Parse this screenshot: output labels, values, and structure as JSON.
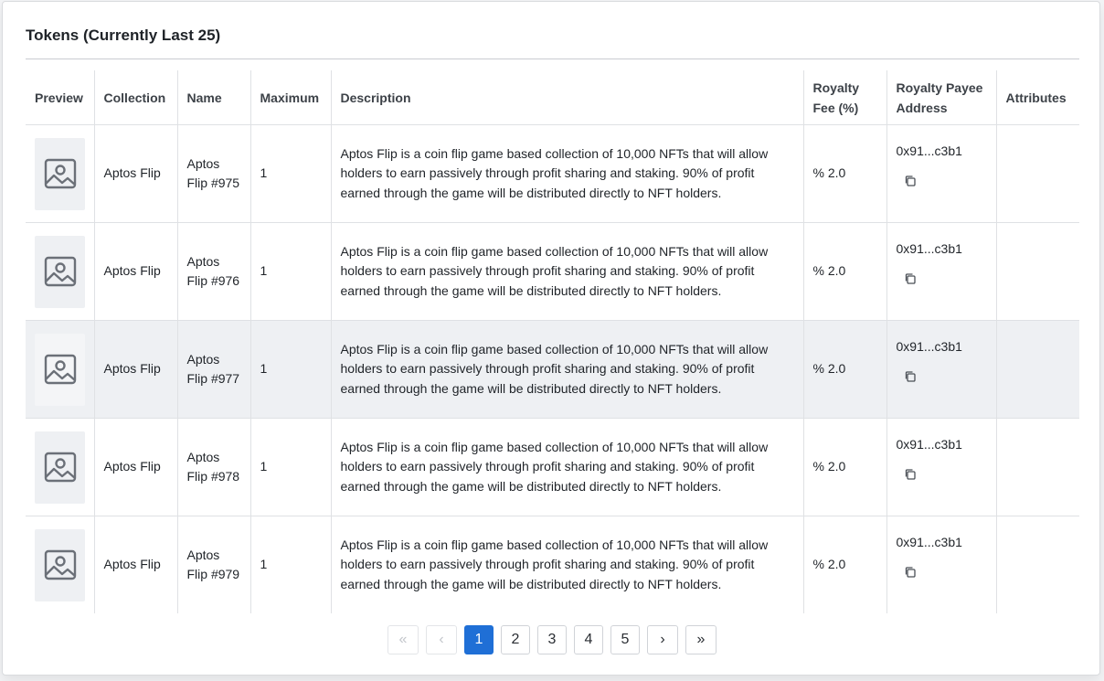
{
  "title": "Tokens (Currently Last 25)",
  "columns": [
    "Preview",
    "Collection",
    "Name",
    "Maximum",
    "Description",
    "Royalty Fee (%)",
    "Royalty Payee Address",
    "Attributes"
  ],
  "rows": [
    {
      "collection": "Aptos Flip",
      "name": "Aptos Flip #975",
      "maximum": "1",
      "description": "Aptos Flip is a coin flip game based collection of 10,000 NFTs that will allow holders to earn passively through profit sharing and staking. 90% of profit earned through the game will be distributed directly to NFT holders.",
      "royalty_fee": "% 2.0",
      "payee": "0x91...c3b1",
      "attributes": ""
    },
    {
      "collection": "Aptos Flip",
      "name": "Aptos Flip #976",
      "maximum": "1",
      "description": "Aptos Flip is a coin flip game based collection of 10,000 NFTs that will allow holders to earn passively through profit sharing and staking. 90% of profit earned through the game will be distributed directly to NFT holders.",
      "royalty_fee": "% 2.0",
      "payee": "0x91...c3b1",
      "attributes": ""
    },
    {
      "collection": "Aptos Flip",
      "name": "Aptos Flip #977",
      "maximum": "1",
      "description": "Aptos Flip is a coin flip game based collection of 10,000 NFTs that will allow holders to earn passively through profit sharing and staking. 90% of profit earned through the game will be distributed directly to NFT holders.",
      "royalty_fee": "% 2.0",
      "payee": "0x91...c3b1",
      "attributes": ""
    },
    {
      "collection": "Aptos Flip",
      "name": "Aptos Flip #978",
      "maximum": "1",
      "description": "Aptos Flip is a coin flip game based collection of 10,000 NFTs that will allow holders to earn passively through profit sharing and staking. 90% of profit earned through the game will be distributed directly to NFT holders.",
      "royalty_fee": "% 2.0",
      "payee": "0x91...c3b1",
      "attributes": ""
    },
    {
      "collection": "Aptos Flip",
      "name": "Aptos Flip #979",
      "maximum": "1",
      "description": "Aptos Flip is a coin flip game based collection of 10,000 NFTs that will allow holders to earn passively through profit sharing and staking. 90% of profit earned through the game will be distributed directly to NFT holders.",
      "royalty_fee": "% 2.0",
      "payee": "0x91...c3b1",
      "attributes": ""
    }
  ],
  "icons": {
    "preview": "image-placeholder-icon",
    "copy": "copy-icon"
  },
  "pagination": {
    "first": "«",
    "prev": "‹",
    "pages": [
      "1",
      "2",
      "3",
      "4",
      "5"
    ],
    "current": "1",
    "next": "›",
    "last": "»"
  },
  "colors": {
    "accent": "#1f6fd6",
    "row_hover": "#eef0f3"
  }
}
